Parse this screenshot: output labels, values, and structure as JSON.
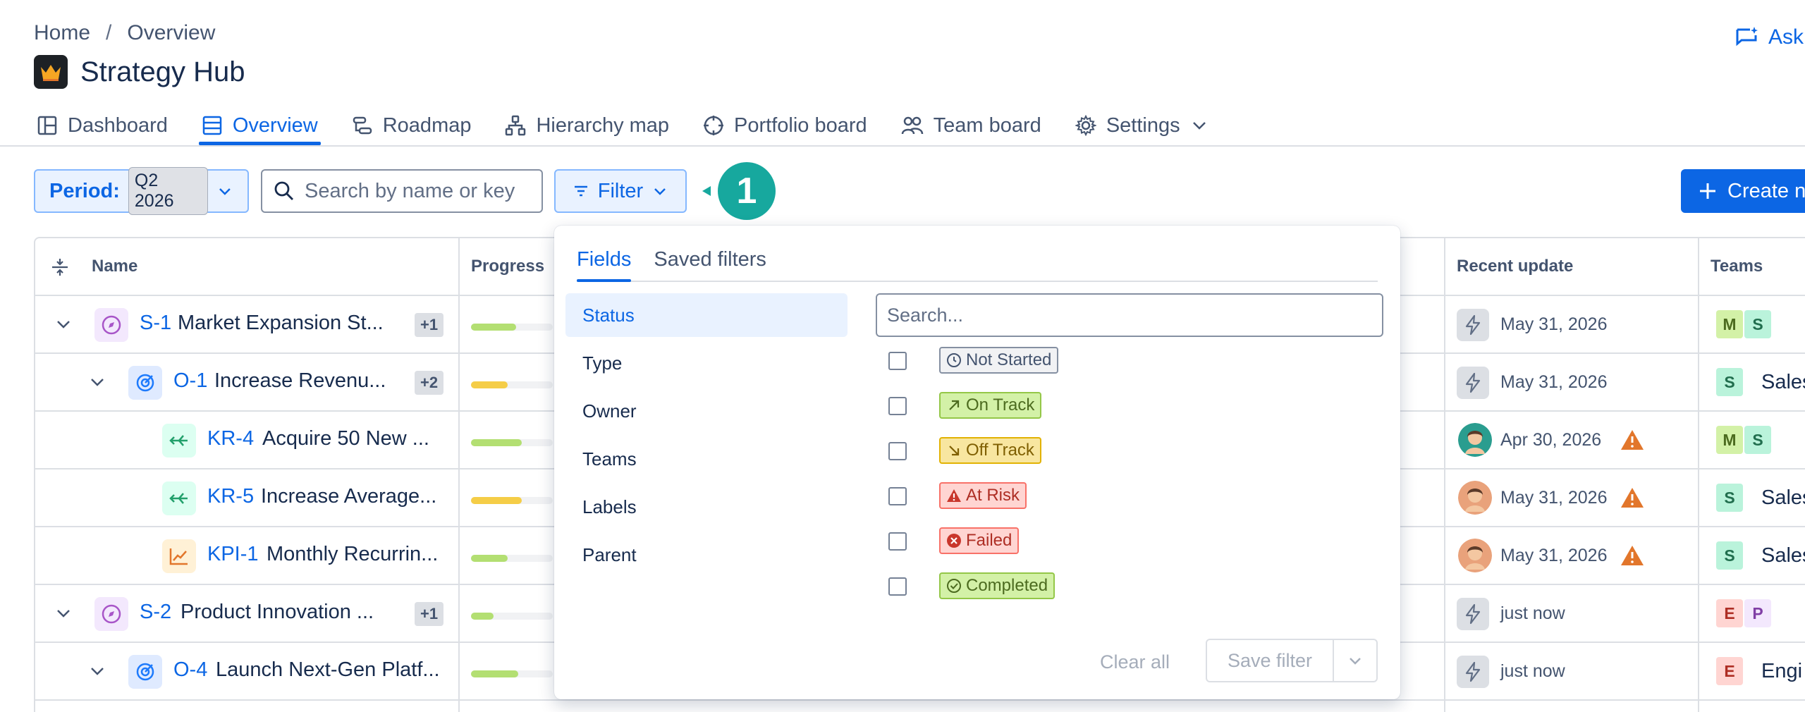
{
  "breadcrumb": {
    "home": "Home",
    "separator": "/",
    "current": "Overview"
  },
  "app": {
    "title": "Strategy Hub",
    "ask_label": "Ask"
  },
  "tabs": [
    {
      "label": "Dashboard",
      "icon": "dashboard-icon"
    },
    {
      "label": "Overview",
      "icon": "list-icon"
    },
    {
      "label": "Roadmap",
      "icon": "roadmap-icon"
    },
    {
      "label": "Hierarchy map",
      "icon": "hierarchy-icon"
    },
    {
      "label": "Portfolio board",
      "icon": "target-icon"
    },
    {
      "label": "Team board",
      "icon": "people-icon"
    },
    {
      "label": "Settings",
      "icon": "gear-icon"
    }
  ],
  "toolbar": {
    "period_label": "Period:",
    "period_value": "Q2 2026",
    "search_placeholder": "Search by name or key",
    "filter_label": "Filter",
    "annotation": "1",
    "create_label": "Create n"
  },
  "table": {
    "headers": {
      "name": "Name",
      "progress": "Progress",
      "recent_update": "Recent update",
      "teams": "Teams"
    },
    "rows": [
      {
        "key": "S-1",
        "name": "Market Expansion St...",
        "more": "+1",
        "progress": 0.55,
        "progress_color": "#b3df72",
        "update": "May 31, 2026",
        "warn": false,
        "teams": [
          "M",
          "S"
        ],
        "team_name": ""
      },
      {
        "key": "O-1",
        "name": "Increase Revenu...",
        "more": "+2",
        "progress": 0.45,
        "progress_color": "#f5cd47",
        "update": "May 31, 2026",
        "warn": false,
        "teams": [
          "S"
        ],
        "team_name": "Sales"
      },
      {
        "key": "KR-4",
        "name": "Acquire 50 New ...",
        "more": "",
        "progress": 0.62,
        "progress_color": "#b3df72",
        "update": "Apr 30, 2026",
        "warn": true,
        "teams": [
          "M",
          "S"
        ],
        "team_name": ""
      },
      {
        "key": "KR-5",
        "name": "Increase Average...",
        "more": "",
        "progress": 0.62,
        "progress_color": "#f5cd47",
        "update": "May 31, 2026",
        "warn": true,
        "teams": [
          "S"
        ],
        "team_name": "Sales"
      },
      {
        "key": "KPI-1",
        "name": "Monthly Recurrin...",
        "more": "",
        "progress": 0.45,
        "progress_color": "#b3df72",
        "update": "May 31, 2026",
        "warn": true,
        "teams": [
          "S"
        ],
        "team_name": "Sales"
      },
      {
        "key": "S-2",
        "name": "Product Innovation ...",
        "more": "+1",
        "progress": 0.28,
        "progress_color": "#b3df72",
        "update": "just now",
        "warn": false,
        "teams": [
          "E",
          "P"
        ],
        "team_name": ""
      },
      {
        "key": "O-4",
        "name": "Launch Next-Gen Platf...",
        "more": "",
        "progress": 0.58,
        "progress_color": "#b3df72",
        "update": "just now",
        "warn": false,
        "teams": [
          "E"
        ],
        "team_name": "Engi"
      }
    ]
  },
  "filter_panel": {
    "tabs": [
      "Fields",
      "Saved filters"
    ],
    "fields": [
      "Status",
      "Type",
      "Owner",
      "Teams",
      "Labels",
      "Parent"
    ],
    "search_placeholder": "Search...",
    "statuses": [
      {
        "label": "Not Started",
        "bg": "#f1f2f4",
        "border": "#8590a2",
        "color": "#44546f"
      },
      {
        "label": "On Track",
        "bg": "#d3f1a7",
        "border": "#94c748",
        "color": "#4c6b1f"
      },
      {
        "label": "Off Track",
        "bg": "#f8e6a0",
        "border": "#e2b203",
        "color": "#7f5f01"
      },
      {
        "label": "At Risk",
        "bg": "#ffd5d2",
        "border": "#f87168",
        "color": "#ae2e24"
      },
      {
        "label": "Failed",
        "bg": "#ffd5d2",
        "border": "#f87168",
        "color": "#ae2e24"
      },
      {
        "label": "Completed",
        "bg": "#d3f1a7",
        "border": "#94c748",
        "color": "#4c6b1f"
      }
    ],
    "clear_label": "Clear all",
    "save_label": "Save filter"
  }
}
